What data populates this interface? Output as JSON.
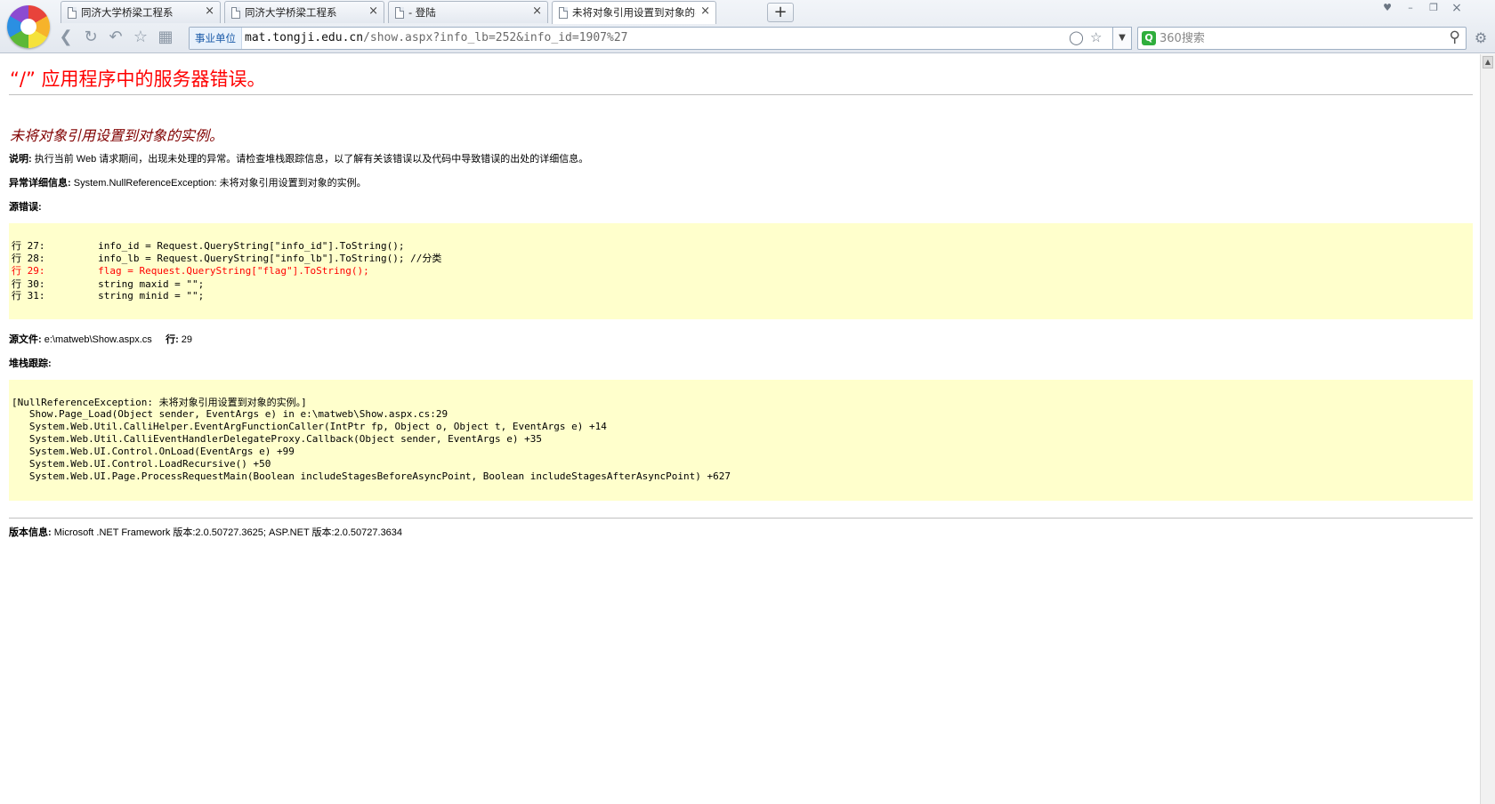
{
  "browser": {
    "tabs": [
      {
        "title": "同济大学桥梁工程系",
        "active": false
      },
      {
        "title": "同济大学桥梁工程系",
        "active": false
      },
      {
        "title": "- 登陆",
        "active": false
      },
      {
        "title": "未将对象引用设置到对象的实例。",
        "active": true
      }
    ],
    "new_tab_label": "+",
    "tab_close_label": "×",
    "address": {
      "cert_label": "事业单位",
      "host": "mat.tongji.edu.cn",
      "path": "/show.aspx?info_lb=252&info_id=1907%27"
    },
    "search": {
      "placeholder": "360搜索"
    },
    "colors": {
      "accent": "#2fae3c",
      "cert": "#1a5aa8"
    }
  },
  "error_page": {
    "title": "“/” 应用程序中的服务器错误。",
    "subtitle": "未将对象引用设置到对象的实例。",
    "description_label": "说明:",
    "description_text": " 执行当前 Web 请求期间，出现未处理的异常。请检查堆栈跟踪信息，以了解有关该错误以及代码中导致错误的出处的详细信息。",
    "exception_label": "异常详细信息:",
    "exception_text": " System.NullReferenceException: 未将对象引用设置到对象的实例。",
    "source_error_label": "源错误:",
    "source_lines": [
      {
        "text": "行 27:         info_id = Request.QueryString[\"info_id\"].ToString();",
        "error": false
      },
      {
        "text": "行 28:         info_lb = Request.QueryString[\"info_lb\"].ToString(); //分类",
        "error": false
      },
      {
        "text": "行 29:         flag = Request.QueryString[\"flag\"].ToString();",
        "error": true
      },
      {
        "text": "行 30:         string maxid = \"\";",
        "error": false
      },
      {
        "text": "行 31:         string minid = \"\";",
        "error": false
      }
    ],
    "source_file_label": "源文件:",
    "source_file_value": " e:\\matweb\\Show.aspx.cs",
    "line_label": "行:",
    "line_value": " 29",
    "stack_trace_label": "堆栈跟踪:",
    "stack_lines": [
      "[NullReferenceException: 未将对象引用设置到对象的实例。]",
      "   Show.Page_Load(Object sender, EventArgs e) in e:\\matweb\\Show.aspx.cs:29",
      "   System.Web.Util.CalliHelper.EventArgFunctionCaller(IntPtr fp, Object o, Object t, EventArgs e) +14",
      "   System.Web.Util.CalliEventHandlerDelegateProxy.Callback(Object sender, EventArgs e) +35",
      "   System.Web.UI.Control.OnLoad(EventArgs e) +99",
      "   System.Web.UI.Control.LoadRecursive() +50",
      "   System.Web.UI.Page.ProcessRequestMain(Boolean includeStagesBeforeAsyncPoint, Boolean includeStagesAfterAsyncPoint) +627"
    ],
    "version_label": "版本信息:",
    "version_text": " Microsoft .NET Framework 版本:2.0.50727.3625; ASP.NET 版本:2.0.50727.3634",
    "colors": {
      "title": "#ff0000",
      "subtitle": "#800000",
      "code_bg": "#ffffcc",
      "error_line": "#ff0000"
    }
  }
}
